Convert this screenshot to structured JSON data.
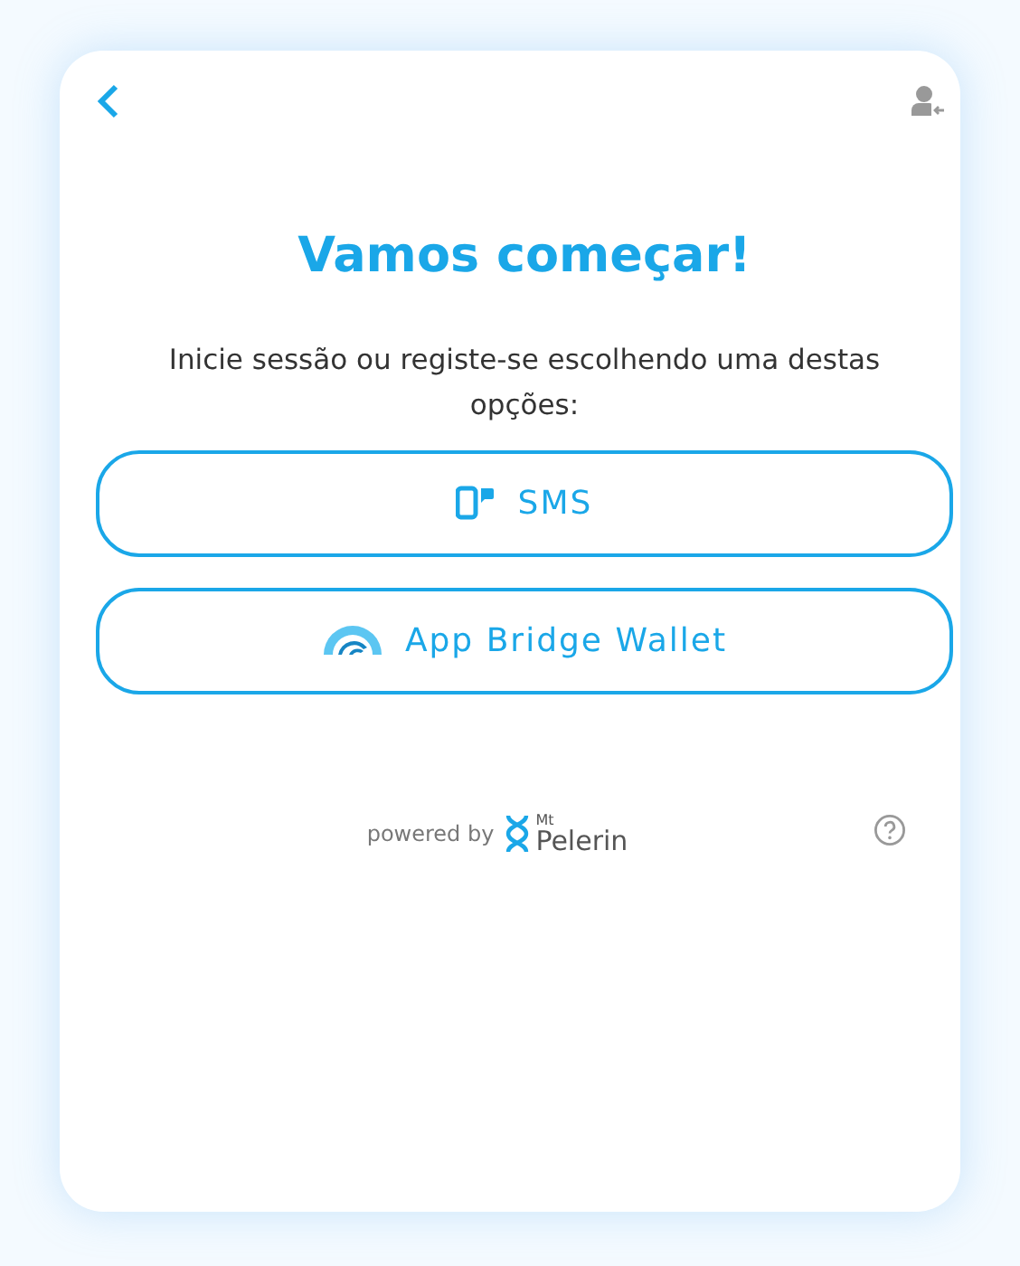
{
  "title": "Vamos começar!",
  "subtitle": "Inicie sessão ou registe-se escolhendo uma destas opções:",
  "options": [
    {
      "kind": "sms",
      "label": "SMS"
    },
    {
      "kind": "bridge",
      "label": "App Bridge Wallet"
    }
  ],
  "footer": {
    "powered_by": "powered by",
    "logo_top": "Mt",
    "logo_main": "Pelerin"
  }
}
